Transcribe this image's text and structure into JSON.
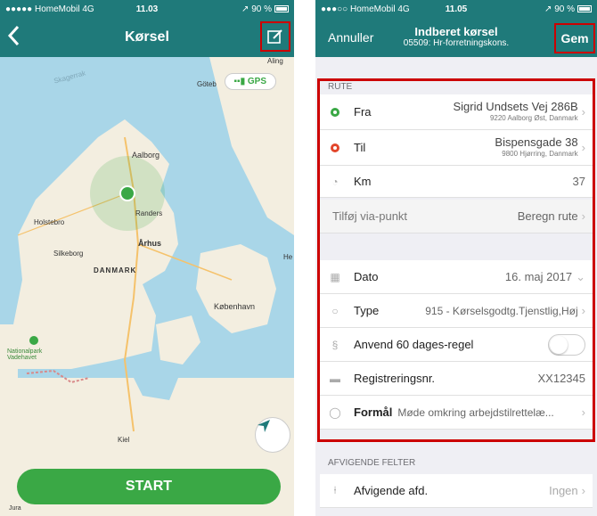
{
  "left": {
    "status": {
      "carrier": "●●●●● HomeMobil 4G",
      "time": "11.03",
      "battery": "↗ 90 %"
    },
    "nav": {
      "title": "Kørsel",
      "back_icon": "chevron-left-icon",
      "edit_icon": "edit-icon"
    },
    "map": {
      "gps_label": "GPS",
      "labels": [
        "Skagerrak",
        "Göteb",
        "Aling",
        "Aalborg",
        "Randers",
        "Holstebro",
        "Århus",
        "Silkeborg",
        "DANMARK",
        "København",
        "He",
        "Nationalpark Vadehavet",
        "Kiel",
        "Jura"
      ]
    },
    "start_label": "START"
  },
  "right": {
    "status": {
      "carrier": "●●●○○ HomeMobil 4G",
      "time": "11.05",
      "battery": "↗ 90 %"
    },
    "nav": {
      "cancel": "Annuller",
      "title": "Indberet kørsel",
      "subtitle": "05509: Hr-forretningskons.",
      "save": "Gem"
    },
    "route_header": "RUTE",
    "from": {
      "label": "Fra",
      "address": "Sigrid Undsets Vej 286B",
      "city": "9220 Aalborg Øst, Danmark"
    },
    "to": {
      "label": "Til",
      "address": "Bispensgade 38",
      "city": "9800 Hjørring, Danmark"
    },
    "km": {
      "label": "Km",
      "value": "37"
    },
    "via": {
      "label": "Tilføj via-punkt",
      "action": "Beregn rute"
    },
    "date": {
      "label": "Dato",
      "value": "16. maj 2017"
    },
    "type": {
      "label": "Type",
      "value": "915 - Kørselsgodtg.Tjenstlig,Høj"
    },
    "rule": {
      "label": "Anvend 60 dages-regel"
    },
    "reg": {
      "label": "Registreringsnr.",
      "value": "XX12345"
    },
    "purpose": {
      "label": "Formål",
      "value": "Møde omkring arbejdstilrettelæ..."
    },
    "deviating_header": "AFVIGENDE FELTER",
    "dept": {
      "label": "Afvigende afd.",
      "value": "Ingen"
    }
  },
  "colors": {
    "teal": "#1f7a7a",
    "green": "#3aa845",
    "red": "#c00000"
  }
}
